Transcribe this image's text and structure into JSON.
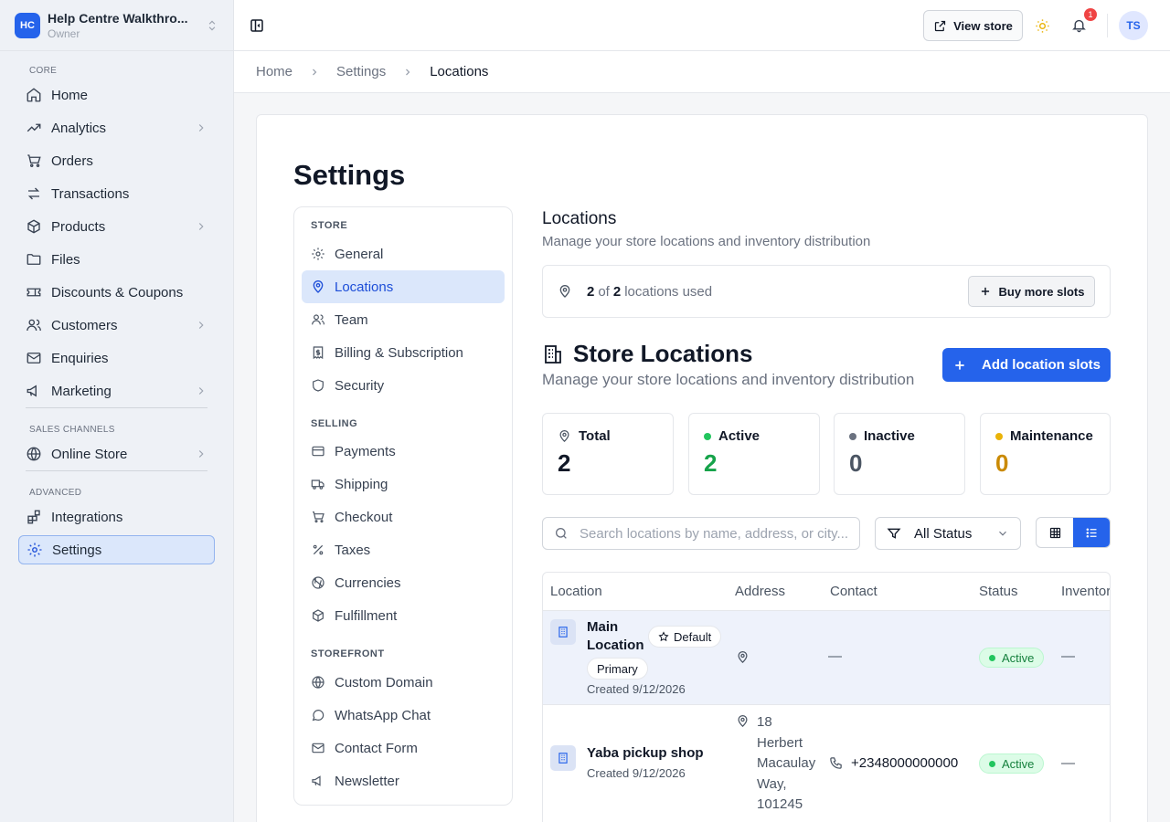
{
  "workspace": {
    "initials": "HC",
    "name": "Help Centre Walkthro...",
    "role": "Owner"
  },
  "sidebar": {
    "sections": [
      {
        "label": "CORE"
      },
      {
        "label": "SALES CHANNELS"
      },
      {
        "label": "ADVANCED"
      }
    ],
    "items": [
      {
        "label": "Home"
      },
      {
        "label": "Analytics"
      },
      {
        "label": "Orders"
      },
      {
        "label": "Transactions"
      },
      {
        "label": "Products"
      },
      {
        "label": "Files"
      },
      {
        "label": "Discounts & Coupons"
      },
      {
        "label": "Customers"
      },
      {
        "label": "Enquiries"
      },
      {
        "label": "Marketing"
      },
      {
        "label": "Online Store"
      },
      {
        "label": "Integrations"
      },
      {
        "label": "Settings"
      }
    ]
  },
  "topbar": {
    "view_store": "View store",
    "notification_count": "1",
    "avatar_initials": "TS"
  },
  "breadcrumb": [
    "Home",
    "Settings",
    "Locations"
  ],
  "page_title": "Settings",
  "settings_nav": {
    "store_label": "STORE",
    "store": [
      "General",
      "Locations",
      "Team",
      "Billing & Subscription",
      "Security"
    ],
    "selling_label": "SELLING",
    "selling": [
      "Payments",
      "Shipping",
      "Checkout",
      "Taxes",
      "Currencies",
      "Fulfillment"
    ],
    "storefront_label": "STOREFRONT",
    "storefront": [
      "Custom Domain",
      "WhatsApp Chat",
      "Contact Form",
      "Newsletter"
    ]
  },
  "locations": {
    "title": "Locations",
    "subtitle": "Manage your store locations and inventory distribution",
    "used": "2",
    "of_word": "of",
    "total_slots": "2",
    "usage_suffix": "locations used",
    "buy_more": "Buy more slots",
    "store_locations_title": "Store Locations",
    "store_locations_subtitle": "Manage your store locations and inventory distribution",
    "add_slots": "Add location slots"
  },
  "stats": [
    {
      "label": "Total",
      "value": "2",
      "color": "#111827"
    },
    {
      "label": "Active",
      "value": "2",
      "color": "#16a34a"
    },
    {
      "label": "Inactive",
      "value": "0",
      "color": "#4b5563"
    },
    {
      "label": "Maintenance",
      "value": "0",
      "color": "#ca8a04"
    }
  ],
  "search": {
    "placeholder": "Search locations by name, address, or city..."
  },
  "filter": {
    "value": "All Status"
  },
  "table": {
    "headers": [
      "Location",
      "Address",
      "Contact",
      "Status",
      "Inventor"
    ],
    "rows": [
      {
        "name_line1": "Main",
        "name_line2": "Location",
        "default_tag": "Default",
        "primary_tag": "Primary",
        "created": "Created 9/12/2026",
        "address": "",
        "contact": "—",
        "status": "Active",
        "inventory": "—"
      },
      {
        "name": "Yaba pickup shop",
        "created": "Created 9/12/2026",
        "address_lines": [
          "18",
          "Herbert",
          "Macaulay",
          "Way,",
          "101245"
        ],
        "contact": "+2348000000000",
        "status": "Active",
        "inventory": "—"
      }
    ]
  }
}
